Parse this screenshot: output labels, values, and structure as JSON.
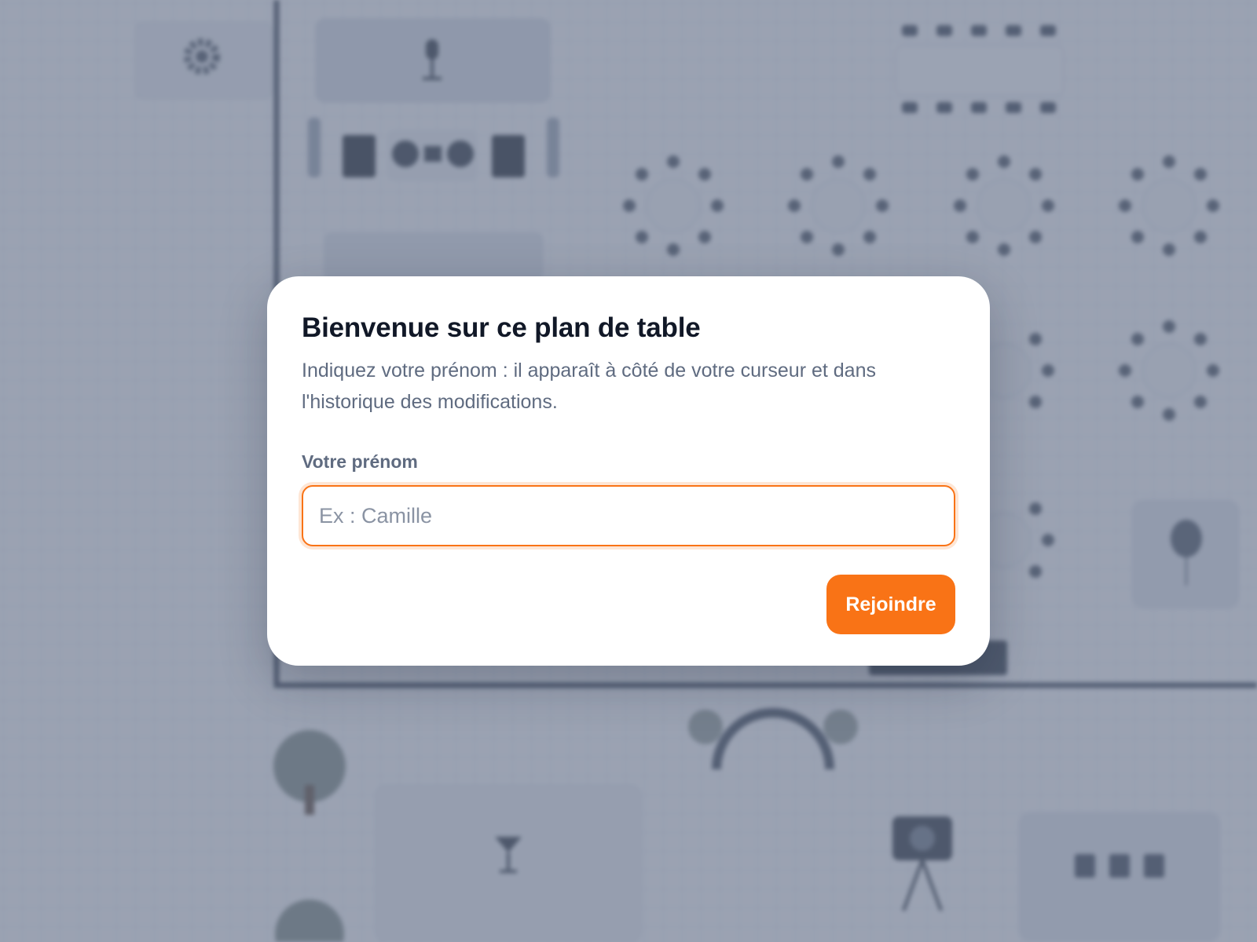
{
  "modal": {
    "title": "Bienvenue sur ce plan de table",
    "description": "Indiquez votre prénom : il apparaît à côté de votre curseur et dans l'historique des modifications.",
    "name_label": "Votre prénom",
    "name_value": "",
    "name_placeholder": "Ex : Camille",
    "join_label": "Rejoindre"
  },
  "colors": {
    "accent": "#f97316",
    "title_text": "#111827",
    "muted_text": "#5f6b80",
    "overlay": "rgba(100,112,136,0.62)"
  },
  "background": {
    "icons": [
      "gear-icon",
      "microphone-icon",
      "speaker-icon",
      "dj-deck-icon",
      "round-table-icon",
      "rectangular-table-icon",
      "tree-icon",
      "arch-icon",
      "cocktail-glass-icon",
      "camera-icon",
      "balloon-icon",
      "trash-bins-icon"
    ]
  }
}
